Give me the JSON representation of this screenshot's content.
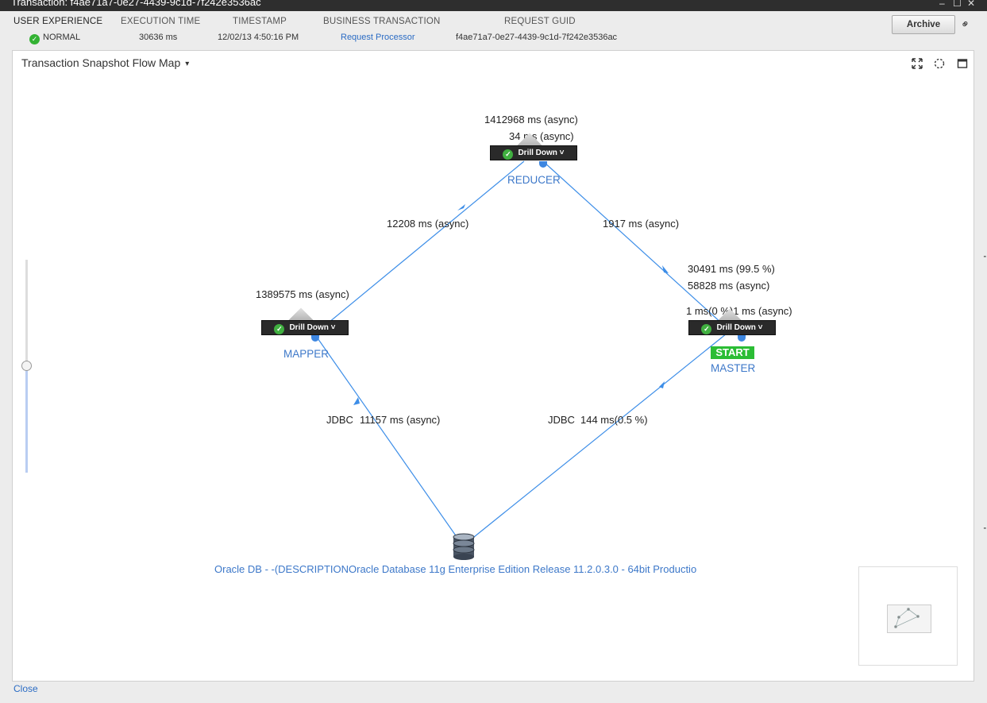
{
  "window": {
    "title": "Transaction: f4ae71a7-0e27-4439-9c1d-7f242e3536ac",
    "controls": [
      "–",
      "☐",
      "✕"
    ]
  },
  "header": {
    "user_experience": {
      "label": "USER EXPERIENCE",
      "value": "NORMAL"
    },
    "execution_time": {
      "label": "EXECUTION TIME",
      "value": "30636 ms"
    },
    "timestamp": {
      "label": "TIMESTAMP",
      "value": "12/02/13 4:50:16 PM"
    },
    "business_transaction": {
      "label": "BUSINESS TRANSACTION",
      "value": "Request Processor"
    },
    "request_guid": {
      "label": "REQUEST GUID",
      "value": "f4ae71a7-0e27-4439-9c1d-7f242e3536ac"
    },
    "archive_label": "Archive"
  },
  "panel": {
    "title": "Transaction Snapshot Flow Map",
    "caret": "▾"
  },
  "nodes": {
    "reducer": {
      "name": "REDUCER",
      "line1": "1412968 ms (async)",
      "line2": "34 ms (async)",
      "drill": "Drill Down"
    },
    "mapper": {
      "name": "MAPPER",
      "line1": "1389575 ms (async)",
      "drill": "Drill Down"
    },
    "master": {
      "name": "MASTER",
      "line1": "1 ms(0 %)1 ms (async)",
      "drill": "Drill Down",
      "start": "START"
    },
    "db": {
      "name": "Oracle DB - -(DESCRIPTIONOracle Database 11g Enterprise Edition Release 11.2.0.3.0 - 64bit Productio"
    }
  },
  "edges": {
    "reducer_mapper": "12208 ms (async)",
    "master_reducer": "1917 ms (async)",
    "master_reducer_b1": "30491 ms (99.5 %)",
    "master_reducer_b2": "58828 ms (async)",
    "mapper_db_type": "JDBC",
    "mapper_db": "11157 ms (async)",
    "master_db_type": "JDBC",
    "master_db": "144 ms(0.5 %)"
  },
  "icons": {
    "status": "check-circle",
    "link": "link-icon",
    "fit": "fit-to-screen-icon",
    "circle": "dashed-circle-icon",
    "maximize": "maximize-icon"
  },
  "colors": {
    "edge": "#3d8ee8",
    "node_text": "#3d78c9",
    "start": "#2bbd35",
    "status_ok": "#33b233"
  },
  "footer": {
    "close_label": "Close"
  }
}
